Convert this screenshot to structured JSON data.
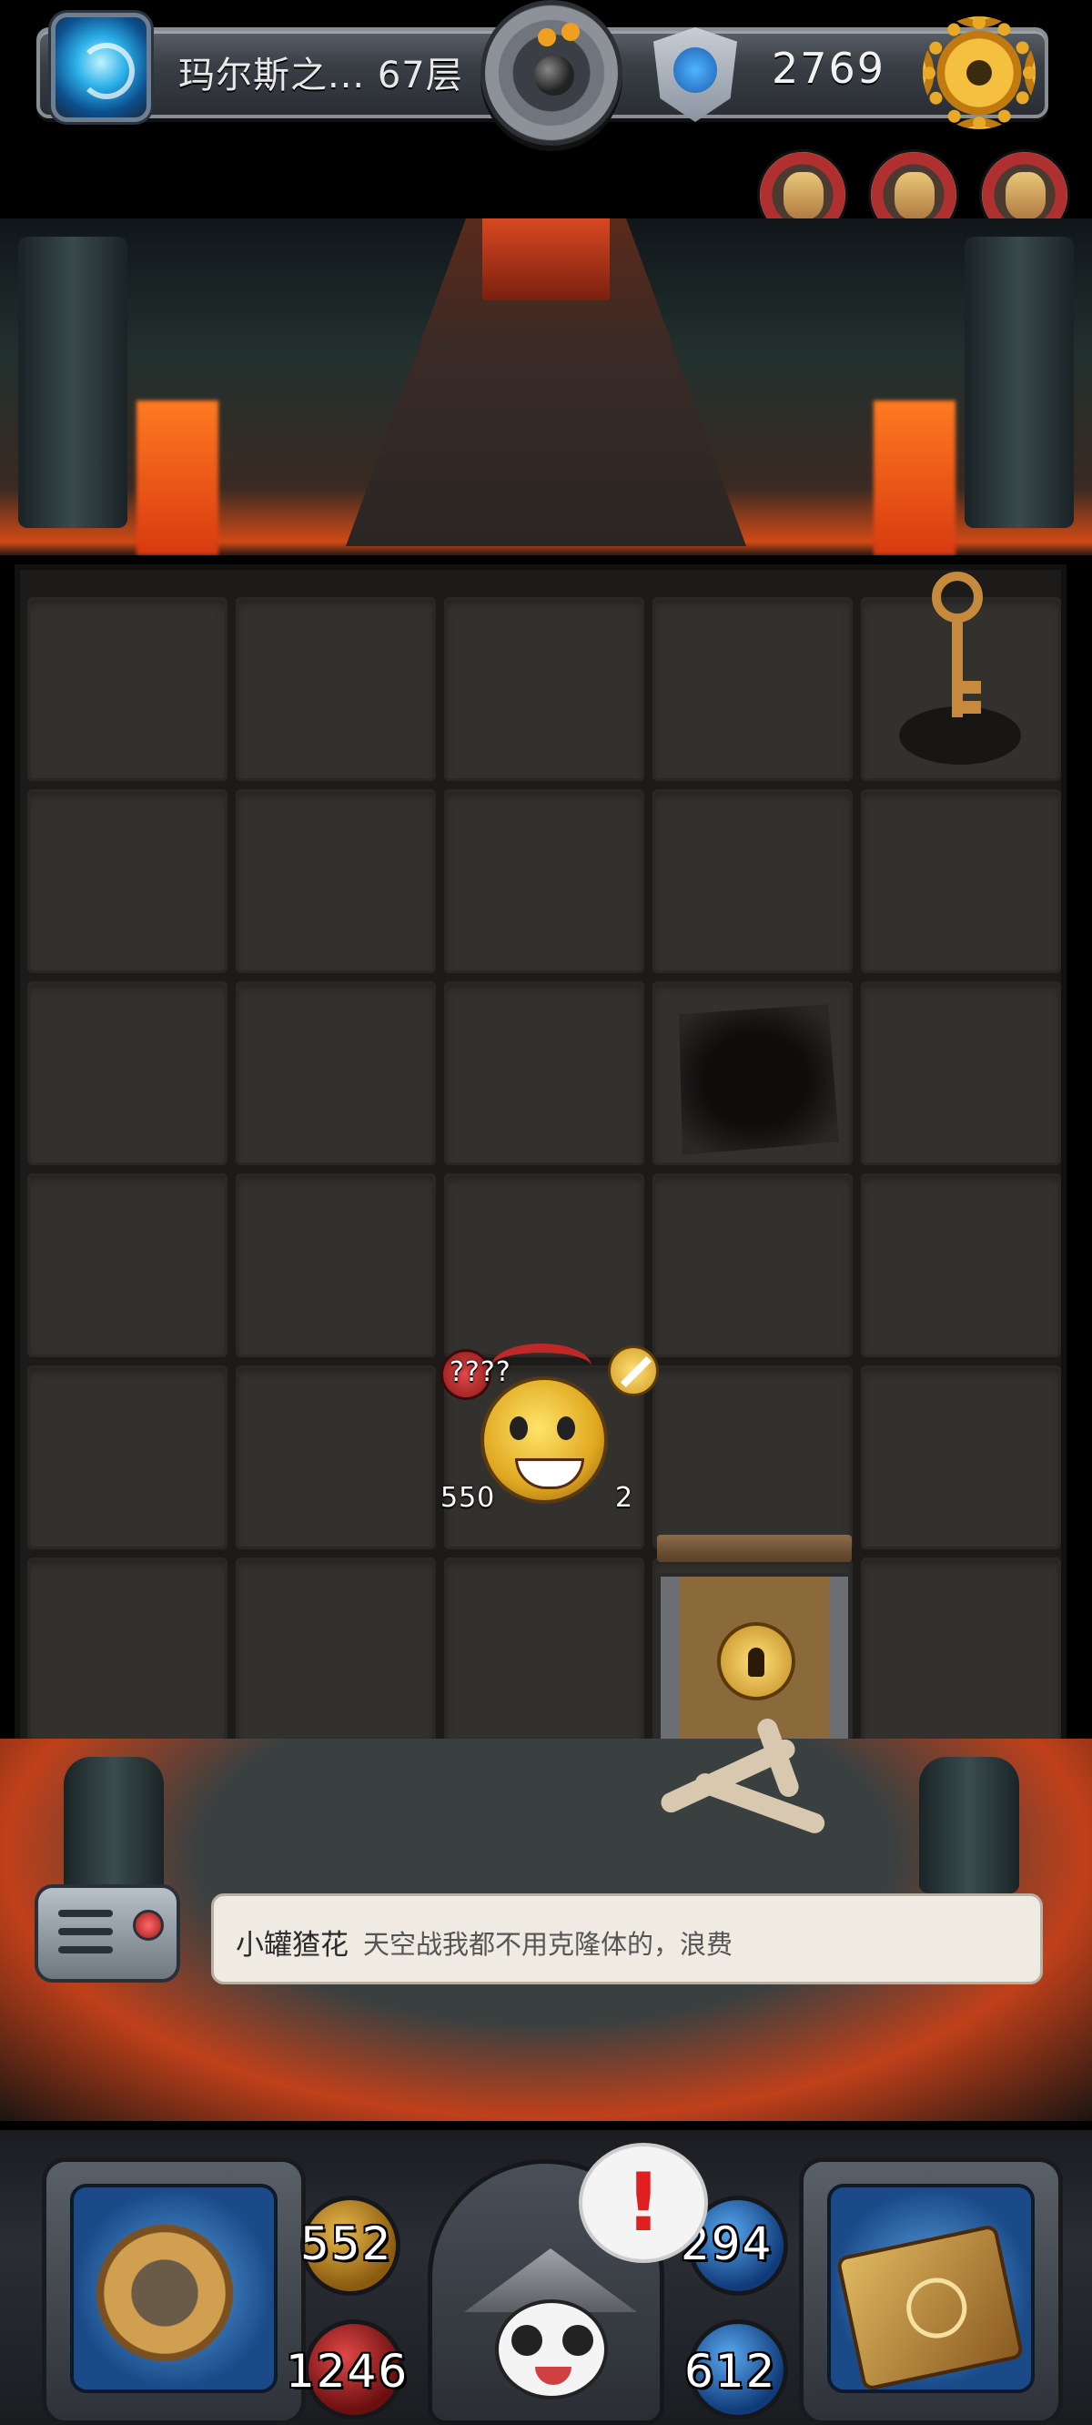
{
  "header": {
    "floor_label": "玛尔斯之... 67层",
    "currency_value": "2769",
    "icons": [
      "portal-icon",
      "bomb-button",
      "shield-icon",
      "gear-icon"
    ]
  },
  "party": [
    "party-member-1",
    "party-member-2",
    "party-member-3"
  ],
  "board": {
    "rows": 6,
    "cols": 5,
    "items": [
      "key",
      "pit",
      "monster",
      "locked-door"
    ]
  },
  "monster": {
    "unknown_label": "????",
    "attack": "550",
    "defense": "2"
  },
  "dialog": {
    "speaker": "小罐猹花",
    "text": "天空战我都不用克隆体的，浪费"
  },
  "stats": {
    "attack": "552",
    "hp": "1246",
    "defense": "294",
    "mana": "612"
  },
  "alert": {
    "mark": "!"
  },
  "colors": {
    "lava": "#d04a16",
    "gold": "#e8b84a",
    "red": "#e04848",
    "blue": "#58a8f0",
    "dialog_bg": "#efebe2"
  }
}
